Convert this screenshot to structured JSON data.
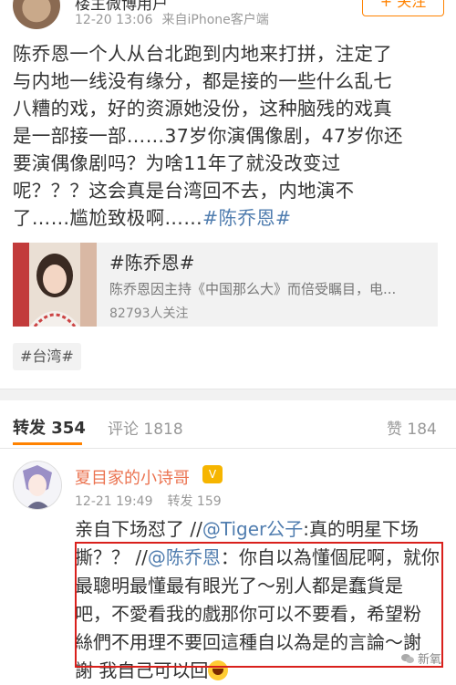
{
  "post": {
    "author": "楼主微博用户",
    "time": "12-20 13:06",
    "source": "来自iPhone客户端",
    "follow_label": "+ 关注",
    "body_lines": [
      "陈乔恩一个人从台北跑到内地来打拼，注定了",
      "与内地一线没有缘分，都是接的一些什么乱七",
      "八糟的戏，好的资源她没份，这种脑残的戏真",
      "是一部接一部……37岁你演偶像剧，47岁你还",
      "要演偶像剧吗？为啥11年了就没改变过",
      "呢？？？这会真是台湾回不去，内地演不"
    ],
    "body_last_text": "了……尴尬致极啊……",
    "body_hashtag": "#陈乔恩#"
  },
  "topic_card": {
    "title": "#陈乔恩#",
    "description": "陈乔恩因主持《中国那么大》而倍受瞩目，电...",
    "followers": "82793人关注"
  },
  "tag": "#台湾#",
  "tabs": {
    "repost": "转发 354",
    "comment": "评论 1818",
    "like": "赞 184"
  },
  "repost": {
    "user": "夏目家的小诗哥",
    "time": "12-21 19:49",
    "count": "转发 159",
    "lines": [
      {
        "text": "亲自下场怼了 //",
        "link": "@Tiger公子",
        "after": ":真的明星下场"
      },
      {
        "text": "撕？？ //",
        "link": "@陈乔恩",
        "after": "：你自以為懂個屁啊，就你"
      },
      {
        "text": "最聰明最懂最有眼光了～别人都是蠢貨是",
        "link": "",
        "after": ""
      },
      {
        "text": "吧，不愛看我的戲那你可以不要看，希望粉",
        "link": "",
        "after": ""
      },
      {
        "text": "絲們不用理不要回這種自以為是的言論～謝",
        "link": "",
        "after": ""
      },
      {
        "text": "謝 我自己可以回",
        "link": "",
        "after": ""
      }
    ]
  },
  "watermark": "新氧",
  "colors": {
    "accent": "#ff8200",
    "link": "#507daf",
    "username": "#eb7350",
    "highlight": "#d9201c"
  }
}
